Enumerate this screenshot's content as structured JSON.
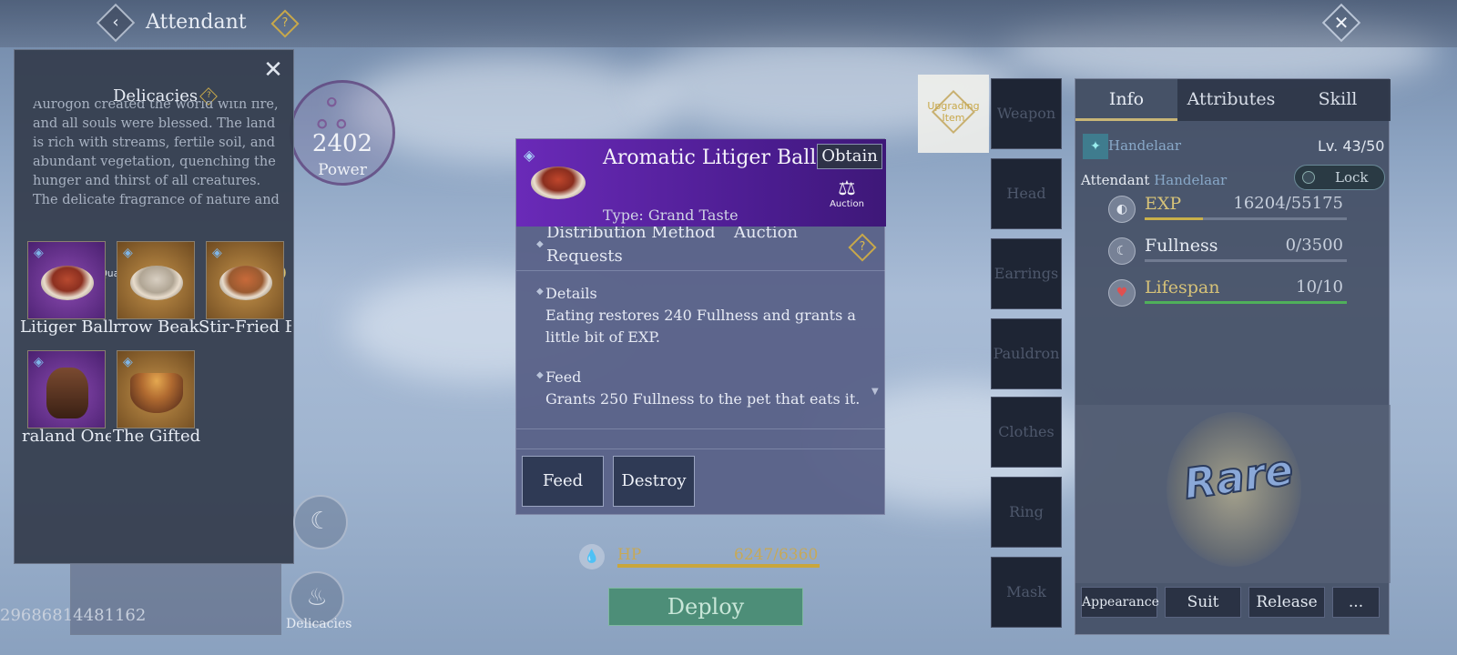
{
  "topbar": {
    "title": "Attendant",
    "help": "?",
    "back": "‹",
    "close": "✕"
  },
  "power": {
    "value": "2402",
    "label": "Power"
  },
  "left_panel": {
    "title": "Delicacies",
    "help": "?",
    "close": "✕",
    "lore": "Aurogon created the world with fire, and all souls were blessed. The land is rich with streams, fertile soil, and abundant vegetation, quenching the hunger and thirst of all creatures. The delicate fragrance of nature and",
    "max_quality": "Reached Max Quality Points: 0/10",
    "hearts": "0",
    "items": [
      {
        "label": "Litiger Ball",
        "badge": "◈"
      },
      {
        "label": "rrow Beak",
        "badge": "◈"
      },
      {
        "label": "Stir-Fried B",
        "badge": "◈"
      },
      {
        "label": "raland One",
        "badge": "◈"
      },
      {
        "label": "The Gifted",
        "badge": "◈"
      }
    ]
  },
  "uid": "29686814481162",
  "bottom_buttons": {
    "delicacies_label": "Delicacies"
  },
  "popup": {
    "title": "Aromatic Litiger Ball",
    "obtain": "Obtain",
    "type": "Type: Grand Taste",
    "auction_label": "Auction",
    "distribution_label": "Distribution Method",
    "distribution_value": "Auction",
    "distribution_value2": "Requests",
    "details_title": "Details",
    "details_text": "Eating restores 240 Fullness and grants a little bit of EXP.",
    "feed_title": "Feed",
    "feed_text": "Grants 250 Fullness to the pet that eats it.",
    "btn_feed": "Feed",
    "btn_destroy": "Destroy"
  },
  "hp": {
    "label": "HP",
    "value": "6247/6360",
    "fill": 0.98
  },
  "deploy": "Deploy",
  "equipment": {
    "upgrade_text": "Upgrading Item",
    "slots": [
      "Weapon",
      "Head",
      "Earrings",
      "Pauldron",
      "Clothes",
      "Ring",
      "Mask"
    ]
  },
  "right_panel": {
    "tabs": [
      "Info",
      "Attributes",
      "Skill"
    ],
    "name": "Handelaar",
    "level": "Lv. 43/50",
    "attendant_label": "Attendant",
    "attendant_name": "Handelaar",
    "lock": "Lock",
    "stats": [
      {
        "label": "EXP",
        "value": "16204/55175",
        "fill": 0.29,
        "color": "#c9b04a"
      },
      {
        "label": "Fullness",
        "value": "0/3500",
        "fill": 0.0,
        "color": "#8a9ab0"
      },
      {
        "label": "Lifespan",
        "value": "10/10",
        "fill": 1.0,
        "color": "#4fb05a"
      }
    ],
    "rarity": "Rare",
    "buttons": [
      "Appearance",
      "Suit",
      "Release",
      "..."
    ]
  }
}
